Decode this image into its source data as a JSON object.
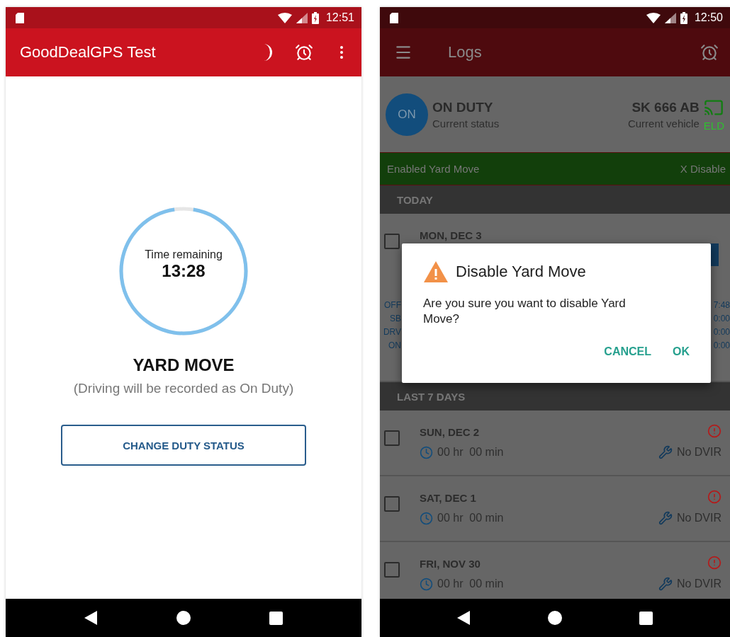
{
  "left_phone": {
    "status_bar": {
      "time": "12:51"
    },
    "app_bar": {
      "title": "GoodDealGPS Test"
    },
    "timer": {
      "label": "Time remaining",
      "value": "13:28",
      "level": 0.95
    },
    "mode": {
      "title": "YARD MOVE",
      "note": "(Driving will be recorded as On Duty)"
    },
    "button": "CHANGE DUTY STATUS"
  },
  "right_phone": {
    "status_bar": {
      "time": "12:50"
    },
    "app_bar": {
      "title": "Logs"
    },
    "status": {
      "badge": "ON",
      "title": "ON DUTY",
      "subtitle": "Current status"
    },
    "vehicle": {
      "title": "SK 666 AB",
      "subtitle": "Current vehicle"
    },
    "eld": {
      "label": "ELD"
    },
    "banner": {
      "text": "Enabled Yard Move",
      "action": "X Disable"
    },
    "today": {
      "header": "TODAY",
      "date": "MON, DEC 3",
      "checked": false,
      "summary": [
        {
          "label": "OFF",
          "value": "7:48"
        },
        {
          "label": "SB",
          "value": "0:00"
        },
        {
          "label": "DRV",
          "value": "0:00"
        },
        {
          "label": "ON",
          "value": "0:00"
        }
      ]
    },
    "last_days": {
      "header": "LAST 7 DAYS",
      "days": [
        {
          "date": "SUN, DEC 2",
          "checked": false,
          "duration": "00 hr  00 min",
          "dvir": "No DVIR"
        },
        {
          "date": "SAT, DEC 1",
          "checked": false,
          "duration": "00 hr  00 min",
          "dvir": "No DVIR"
        },
        {
          "date": "FRI, NOV 30",
          "checked": false,
          "duration": "00 hr  00 min",
          "dvir": "No DVIR"
        }
      ]
    },
    "dialog": {
      "title": "Disable Yard Move",
      "message": "Are you sure you want to disable Yard Move?",
      "buttons": [
        "CANCEL",
        "OK"
      ]
    }
  }
}
